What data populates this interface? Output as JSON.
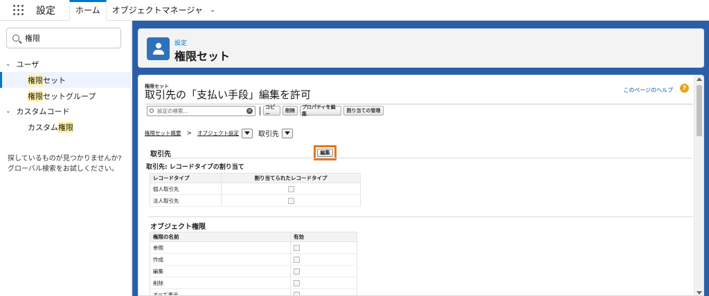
{
  "top": {
    "app_name": "設定",
    "tabs": [
      {
        "label": "ホーム"
      },
      {
        "label": "オブジェクトマネージャ"
      }
    ]
  },
  "sidebar": {
    "search_value": "権限",
    "groups": [
      {
        "label": "ユーザ",
        "items": [
          {
            "pre": "",
            "hl": "権限",
            "post": "セット"
          },
          {
            "pre": "",
            "hl": "権限",
            "post": "セットグループ"
          }
        ]
      },
      {
        "label": "カスタムコード",
        "items": [
          {
            "pre": "カスタム",
            "hl": "権限",
            "post": ""
          }
        ]
      }
    ],
    "not_found_line1": "探しているものが見つかりませんか?",
    "not_found_line2": "グローバル検索をお試しください。"
  },
  "header": {
    "breadcrumb": "設定",
    "title": "権限セット"
  },
  "content": {
    "small_label": "権限セット",
    "title": "取引先の「支払い手段」編集を許可",
    "help_link": "このページのヘルプ",
    "help_icon": "?",
    "search_placeholder": "設定の検索...",
    "buttons": [
      "コピー",
      "削除",
      "プロパティを編集",
      "割り当ての管理"
    ],
    "crumb_overview": "権限セット概要",
    "crumb_object_settings": "オブジェクト設定",
    "crumb_current": "取引先",
    "section_title": "取引先",
    "edit_label": "編集",
    "record_type_title": "取引先: レコードタイプの割り当て",
    "record_type_headers": [
      "レコードタイプ",
      "割り当てられたレコードタイプ"
    ],
    "record_types": [
      "個人取引先",
      "法人取引先"
    ],
    "object_perm_title": "オブジェクト権限",
    "object_perm_headers": [
      "権限の名前",
      "有効"
    ],
    "object_perms": [
      "参照",
      "作成",
      "編集",
      "削除",
      "すべて表示"
    ]
  }
}
